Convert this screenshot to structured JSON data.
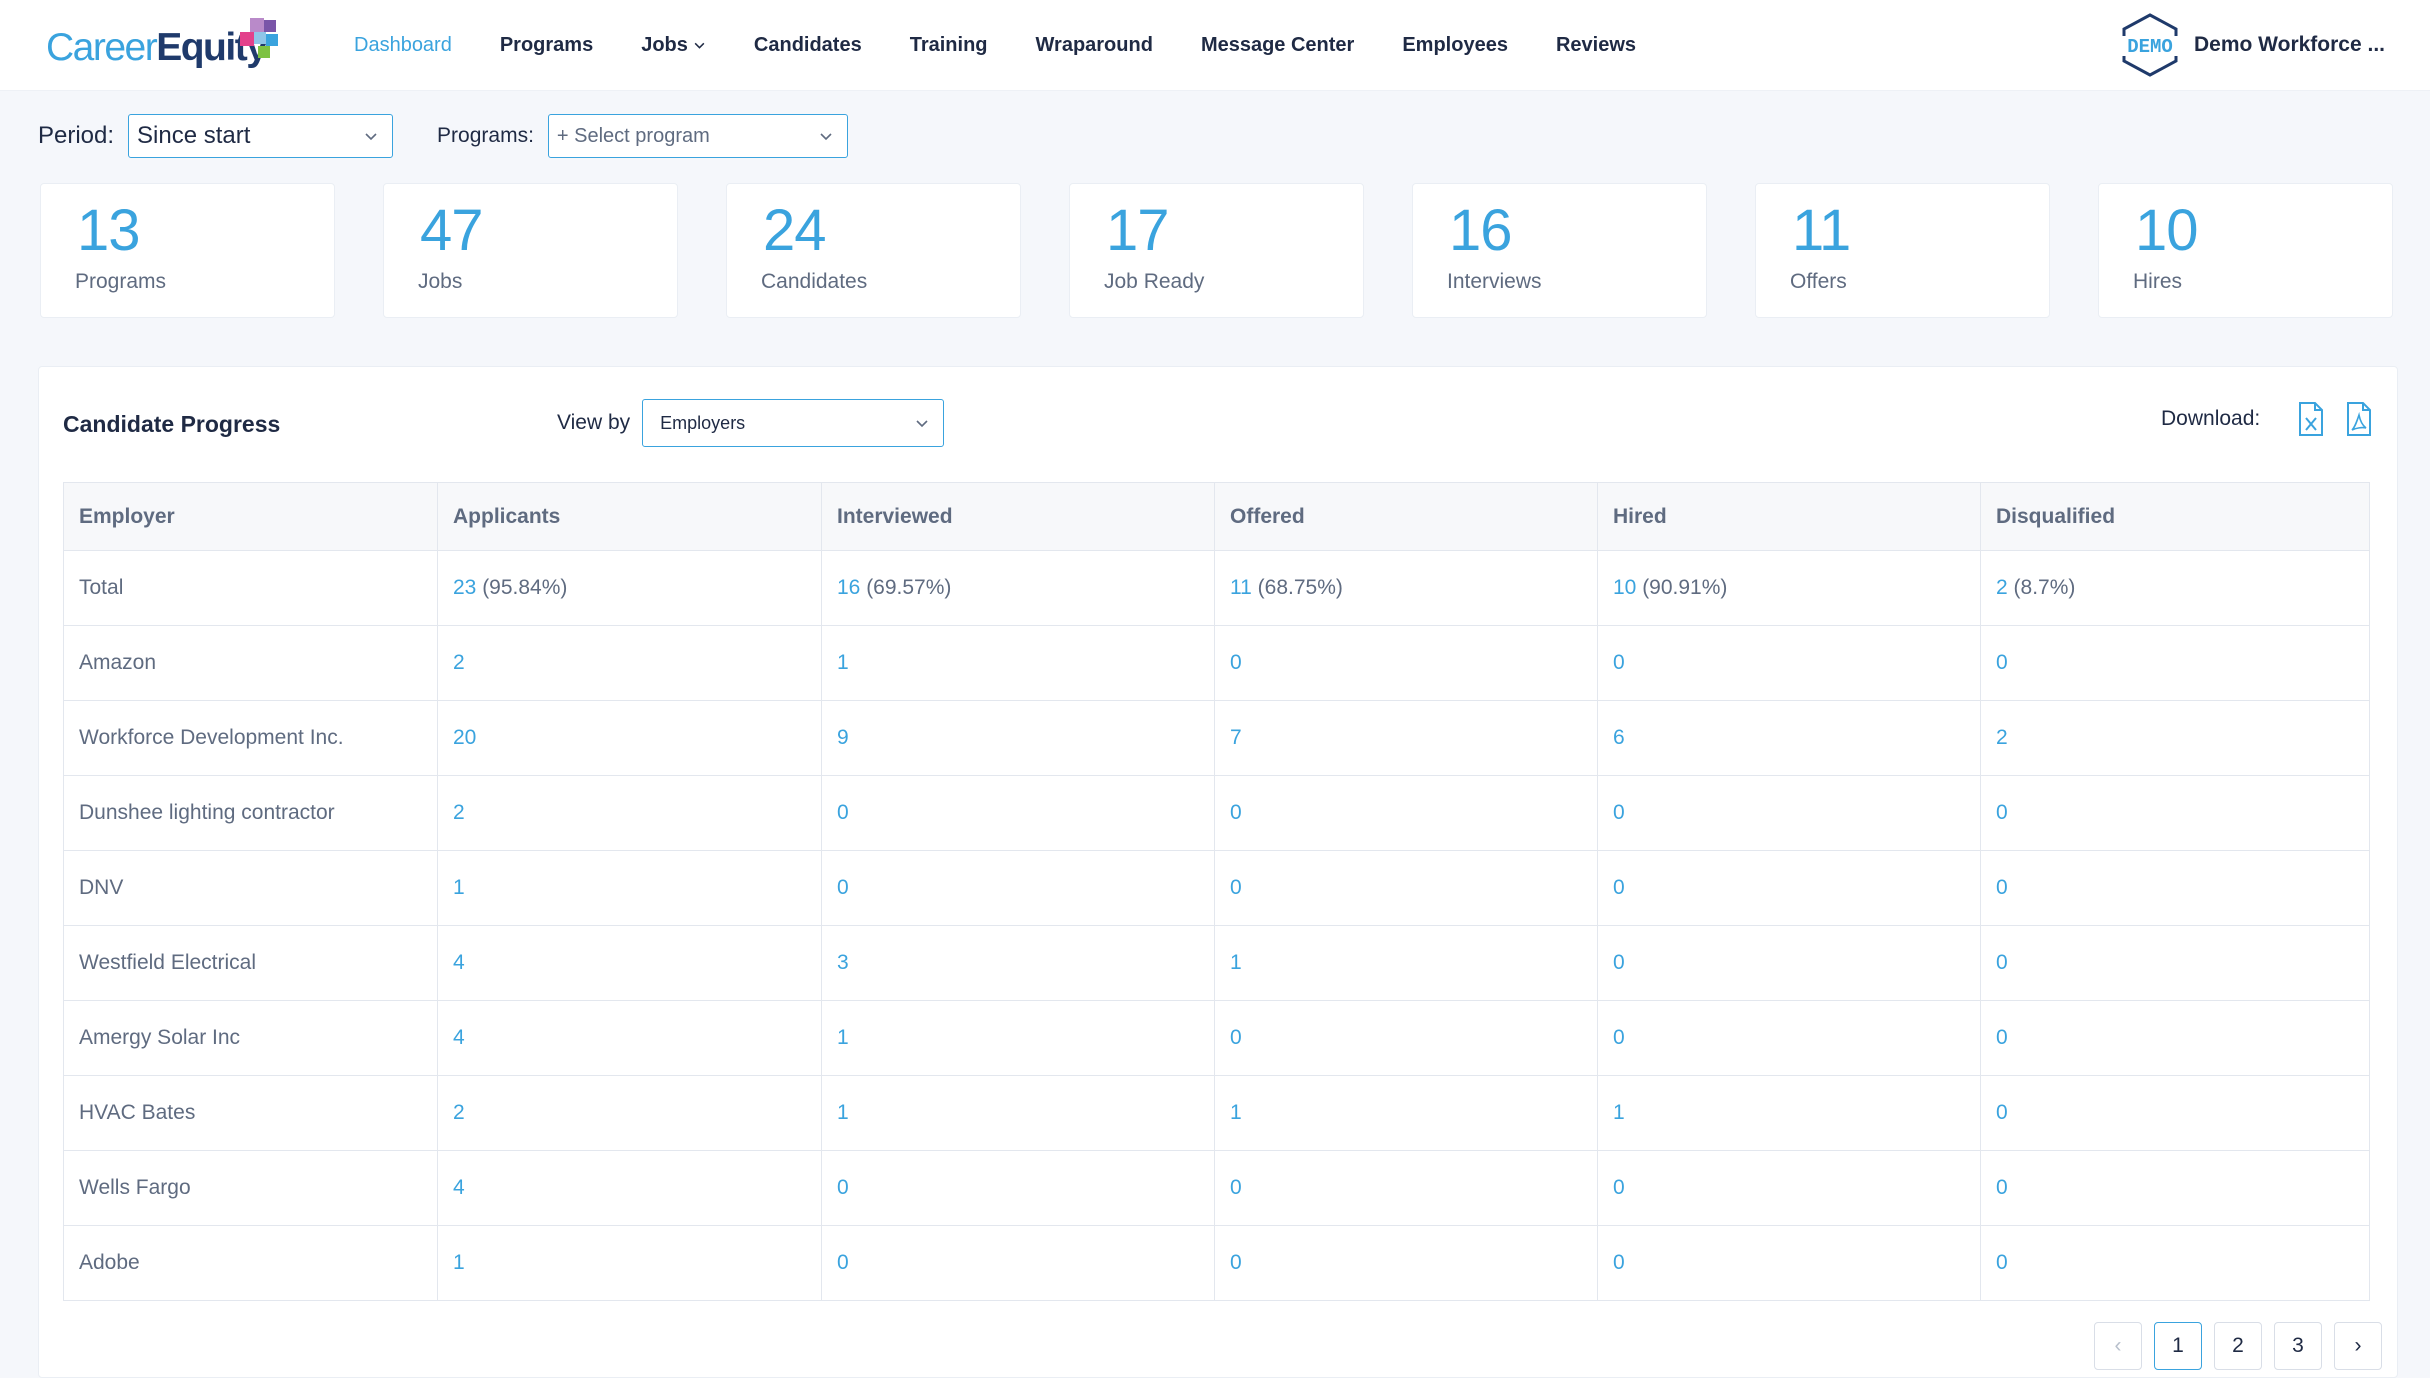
{
  "brand": {
    "career": "Career",
    "equity": "Equity",
    "colors": {
      "primary": "#3aa3de",
      "navy": "#1f3a6b",
      "text": "#1f2a44",
      "muted": "#5f6b80"
    }
  },
  "nav": [
    {
      "label": "Dashboard",
      "active": true
    },
    {
      "label": "Programs"
    },
    {
      "label": "Jobs",
      "dropdown": true
    },
    {
      "label": "Candidates"
    },
    {
      "label": "Training"
    },
    {
      "label": "Wraparound"
    },
    {
      "label": "Message Center"
    },
    {
      "label": "Employees"
    },
    {
      "label": "Reviews"
    }
  ],
  "user": {
    "badge": "DEMO",
    "name": "Demo Workforce ..."
  },
  "filters": {
    "period_label": "Period:",
    "period_value": "Since start",
    "programs_label": "Programs:",
    "programs_placeholder": "+ Select program"
  },
  "stats": [
    {
      "value": "13",
      "label": "Programs"
    },
    {
      "value": "47",
      "label": "Jobs"
    },
    {
      "value": "24",
      "label": "Candidates"
    },
    {
      "value": "17",
      "label": "Job Ready"
    },
    {
      "value": "16",
      "label": "Interviews"
    },
    {
      "value": "11",
      "label": "Offers"
    },
    {
      "value": "10",
      "label": "Hires"
    }
  ],
  "progress": {
    "title": "Candidate Progress",
    "view_by_label": "View by",
    "view_by_value": "Employers",
    "download_label": "Download:",
    "download_icons": [
      "excel-file-icon",
      "pdf-file-icon"
    ],
    "columns": [
      "Employer",
      "Applicants",
      "Interviewed",
      "Offered",
      "Hired",
      "Disqualified"
    ],
    "rows": [
      {
        "employer": "Total",
        "cells": [
          {
            "n": "23",
            "p": " (95.84%)"
          },
          {
            "n": "16",
            "p": " (69.57%)"
          },
          {
            "n": "11",
            "p": " (68.75%)"
          },
          {
            "n": "10",
            "p": " (90.91%)"
          },
          {
            "n": "2",
            "p": " (8.7%)"
          }
        ]
      },
      {
        "employer": "Amazon",
        "cells": [
          {
            "n": "2"
          },
          {
            "n": "1"
          },
          {
            "n": "0"
          },
          {
            "n": "0"
          },
          {
            "n": "0"
          }
        ]
      },
      {
        "employer": "Workforce Development Inc.",
        "cells": [
          {
            "n": "20"
          },
          {
            "n": "9"
          },
          {
            "n": "7"
          },
          {
            "n": "6"
          },
          {
            "n": "2"
          }
        ]
      },
      {
        "employer": "Dunshee lighting contractor",
        "cells": [
          {
            "n": "2"
          },
          {
            "n": "0"
          },
          {
            "n": "0"
          },
          {
            "n": "0"
          },
          {
            "n": "0"
          }
        ]
      },
      {
        "employer": "DNV",
        "cells": [
          {
            "n": "1"
          },
          {
            "n": "0"
          },
          {
            "n": "0"
          },
          {
            "n": "0"
          },
          {
            "n": "0"
          }
        ]
      },
      {
        "employer": "Westfield Electrical",
        "cells": [
          {
            "n": "4"
          },
          {
            "n": "3"
          },
          {
            "n": "1"
          },
          {
            "n": "0"
          },
          {
            "n": "0"
          }
        ]
      },
      {
        "employer": "Amergy Solar Inc",
        "cells": [
          {
            "n": "4"
          },
          {
            "n": "1"
          },
          {
            "n": "0"
          },
          {
            "n": "0"
          },
          {
            "n": "0"
          }
        ]
      },
      {
        "employer": "HVAC Bates",
        "cells": [
          {
            "n": "2"
          },
          {
            "n": "1"
          },
          {
            "n": "1"
          },
          {
            "n": "1"
          },
          {
            "n": "0"
          }
        ]
      },
      {
        "employer": "Wells Fargo",
        "cells": [
          {
            "n": "4"
          },
          {
            "n": "0"
          },
          {
            "n": "0"
          },
          {
            "n": "0"
          },
          {
            "n": "0"
          }
        ]
      },
      {
        "employer": "Adobe",
        "cells": [
          {
            "n": "1"
          },
          {
            "n": "0"
          },
          {
            "n": "0"
          },
          {
            "n": "0"
          },
          {
            "n": "0"
          }
        ]
      }
    ]
  },
  "pagination": {
    "prev": "‹",
    "pages": [
      "1",
      "2",
      "3"
    ],
    "current": "1",
    "next": "›"
  }
}
